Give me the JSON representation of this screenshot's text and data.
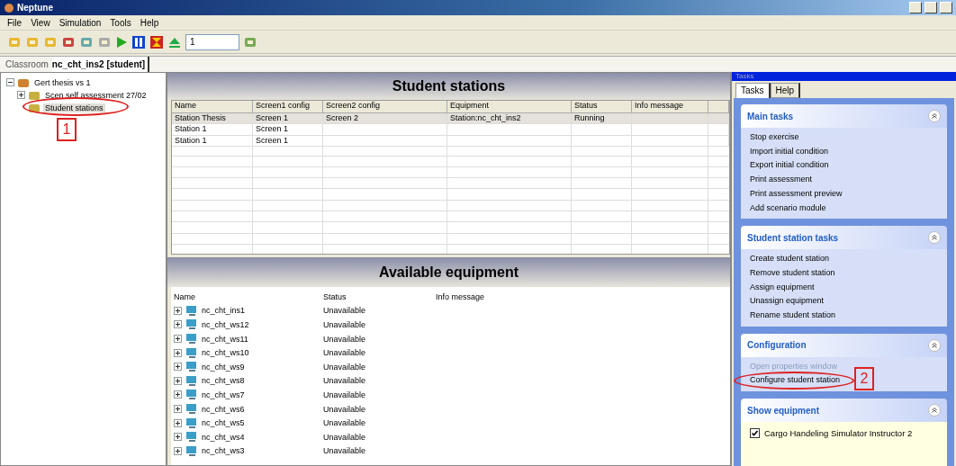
{
  "window": {
    "title": "Neptune"
  },
  "menu": [
    "File",
    "View",
    "Simulation",
    "Tools",
    "Help"
  ],
  "toolbar": {
    "speed": "1"
  },
  "document_tab": {
    "label": "Classroom",
    "value": "nc_cht_ins2 [student]"
  },
  "tree": [
    {
      "label": "Gert thesis vs 1",
      "expanded": true,
      "children": [
        {
          "label": "Scen self assessment 27/02",
          "expanded": false,
          "selected": false
        },
        {
          "label": "Student stations",
          "selected": true
        }
      ]
    }
  ],
  "student_stations": {
    "title": "Student stations",
    "columns": [
      "Name",
      "Screen1 config",
      "Screen2 config",
      "Equipment",
      "Status",
      "Info message"
    ],
    "rows": [
      {
        "cells": [
          "Station Thesis",
          "Screen 1",
          "Screen 2",
          "Station:nc_cht_ins2",
          "Running",
          ""
        ],
        "selected": true
      },
      {
        "cells": [
          "Station 1",
          "Screen 1",
          "",
          "",
          "",
          ""
        ],
        "selected": false
      },
      {
        "cells": [
          "Station 1",
          "Screen 1",
          "",
          "",
          "",
          ""
        ],
        "selected": false
      }
    ]
  },
  "available_equipment": {
    "title": "Available equipment",
    "columns": [
      "Name",
      "Status",
      "Info message"
    ],
    "rows": [
      {
        "name": "nc_cht_ins1",
        "status": "Unavailable"
      },
      {
        "name": "nc_cht_ws12",
        "status": "Unavailable"
      },
      {
        "name": "nc_cht_ws11",
        "status": "Unavailable"
      },
      {
        "name": "nc_cht_ws10",
        "status": "Unavailable"
      },
      {
        "name": "nc_cht_ws9",
        "status": "Unavailable"
      },
      {
        "name": "nc_cht_ws8",
        "status": "Unavailable"
      },
      {
        "name": "nc_cht_ws7",
        "status": "Unavailable"
      },
      {
        "name": "nc_cht_ws6",
        "status": "Unavailable"
      },
      {
        "name": "nc_cht_ws5",
        "status": "Unavailable"
      },
      {
        "name": "nc_cht_ws4",
        "status": "Unavailable"
      },
      {
        "name": "nc_cht_ws3",
        "status": "Unavailable"
      }
    ]
  },
  "tasks_pane": {
    "title": "Tasks",
    "tabs": [
      {
        "label": "Tasks",
        "selected": true
      },
      {
        "label": "Help",
        "selected": false
      }
    ],
    "groups": [
      {
        "title": "Main tasks",
        "kind": "links",
        "items": [
          {
            "label": "Stop exercise",
            "disabled": false
          },
          {
            "label": "Import initial condition",
            "disabled": false
          },
          {
            "label": "Export initial condition",
            "disabled": false
          },
          {
            "label": "Print assessment",
            "disabled": false
          },
          {
            "label": "Print assessment preview",
            "disabled": false
          },
          {
            "label": "Add scenario module",
            "disabled": false
          }
        ]
      },
      {
        "title": "Student station tasks",
        "kind": "links",
        "items": [
          {
            "label": "Create student station",
            "disabled": false
          },
          {
            "label": "Remove student station",
            "disabled": false
          },
          {
            "label": "Assign equipment",
            "disabled": false
          },
          {
            "label": "Unassign equipment",
            "disabled": false
          },
          {
            "label": "Rename student station",
            "disabled": false
          }
        ]
      },
      {
        "title": "Configuration",
        "kind": "links",
        "items": [
          {
            "label": "Open properties window",
            "disabled": true
          },
          {
            "label": "Configure student station",
            "disabled": false
          }
        ]
      },
      {
        "title": "Show equipment",
        "kind": "checks",
        "items": [
          {
            "label": "Cargo Handeling Simulator Instructor 2",
            "checked": true
          }
        ]
      }
    ]
  },
  "annotations": [
    "1",
    "2"
  ]
}
